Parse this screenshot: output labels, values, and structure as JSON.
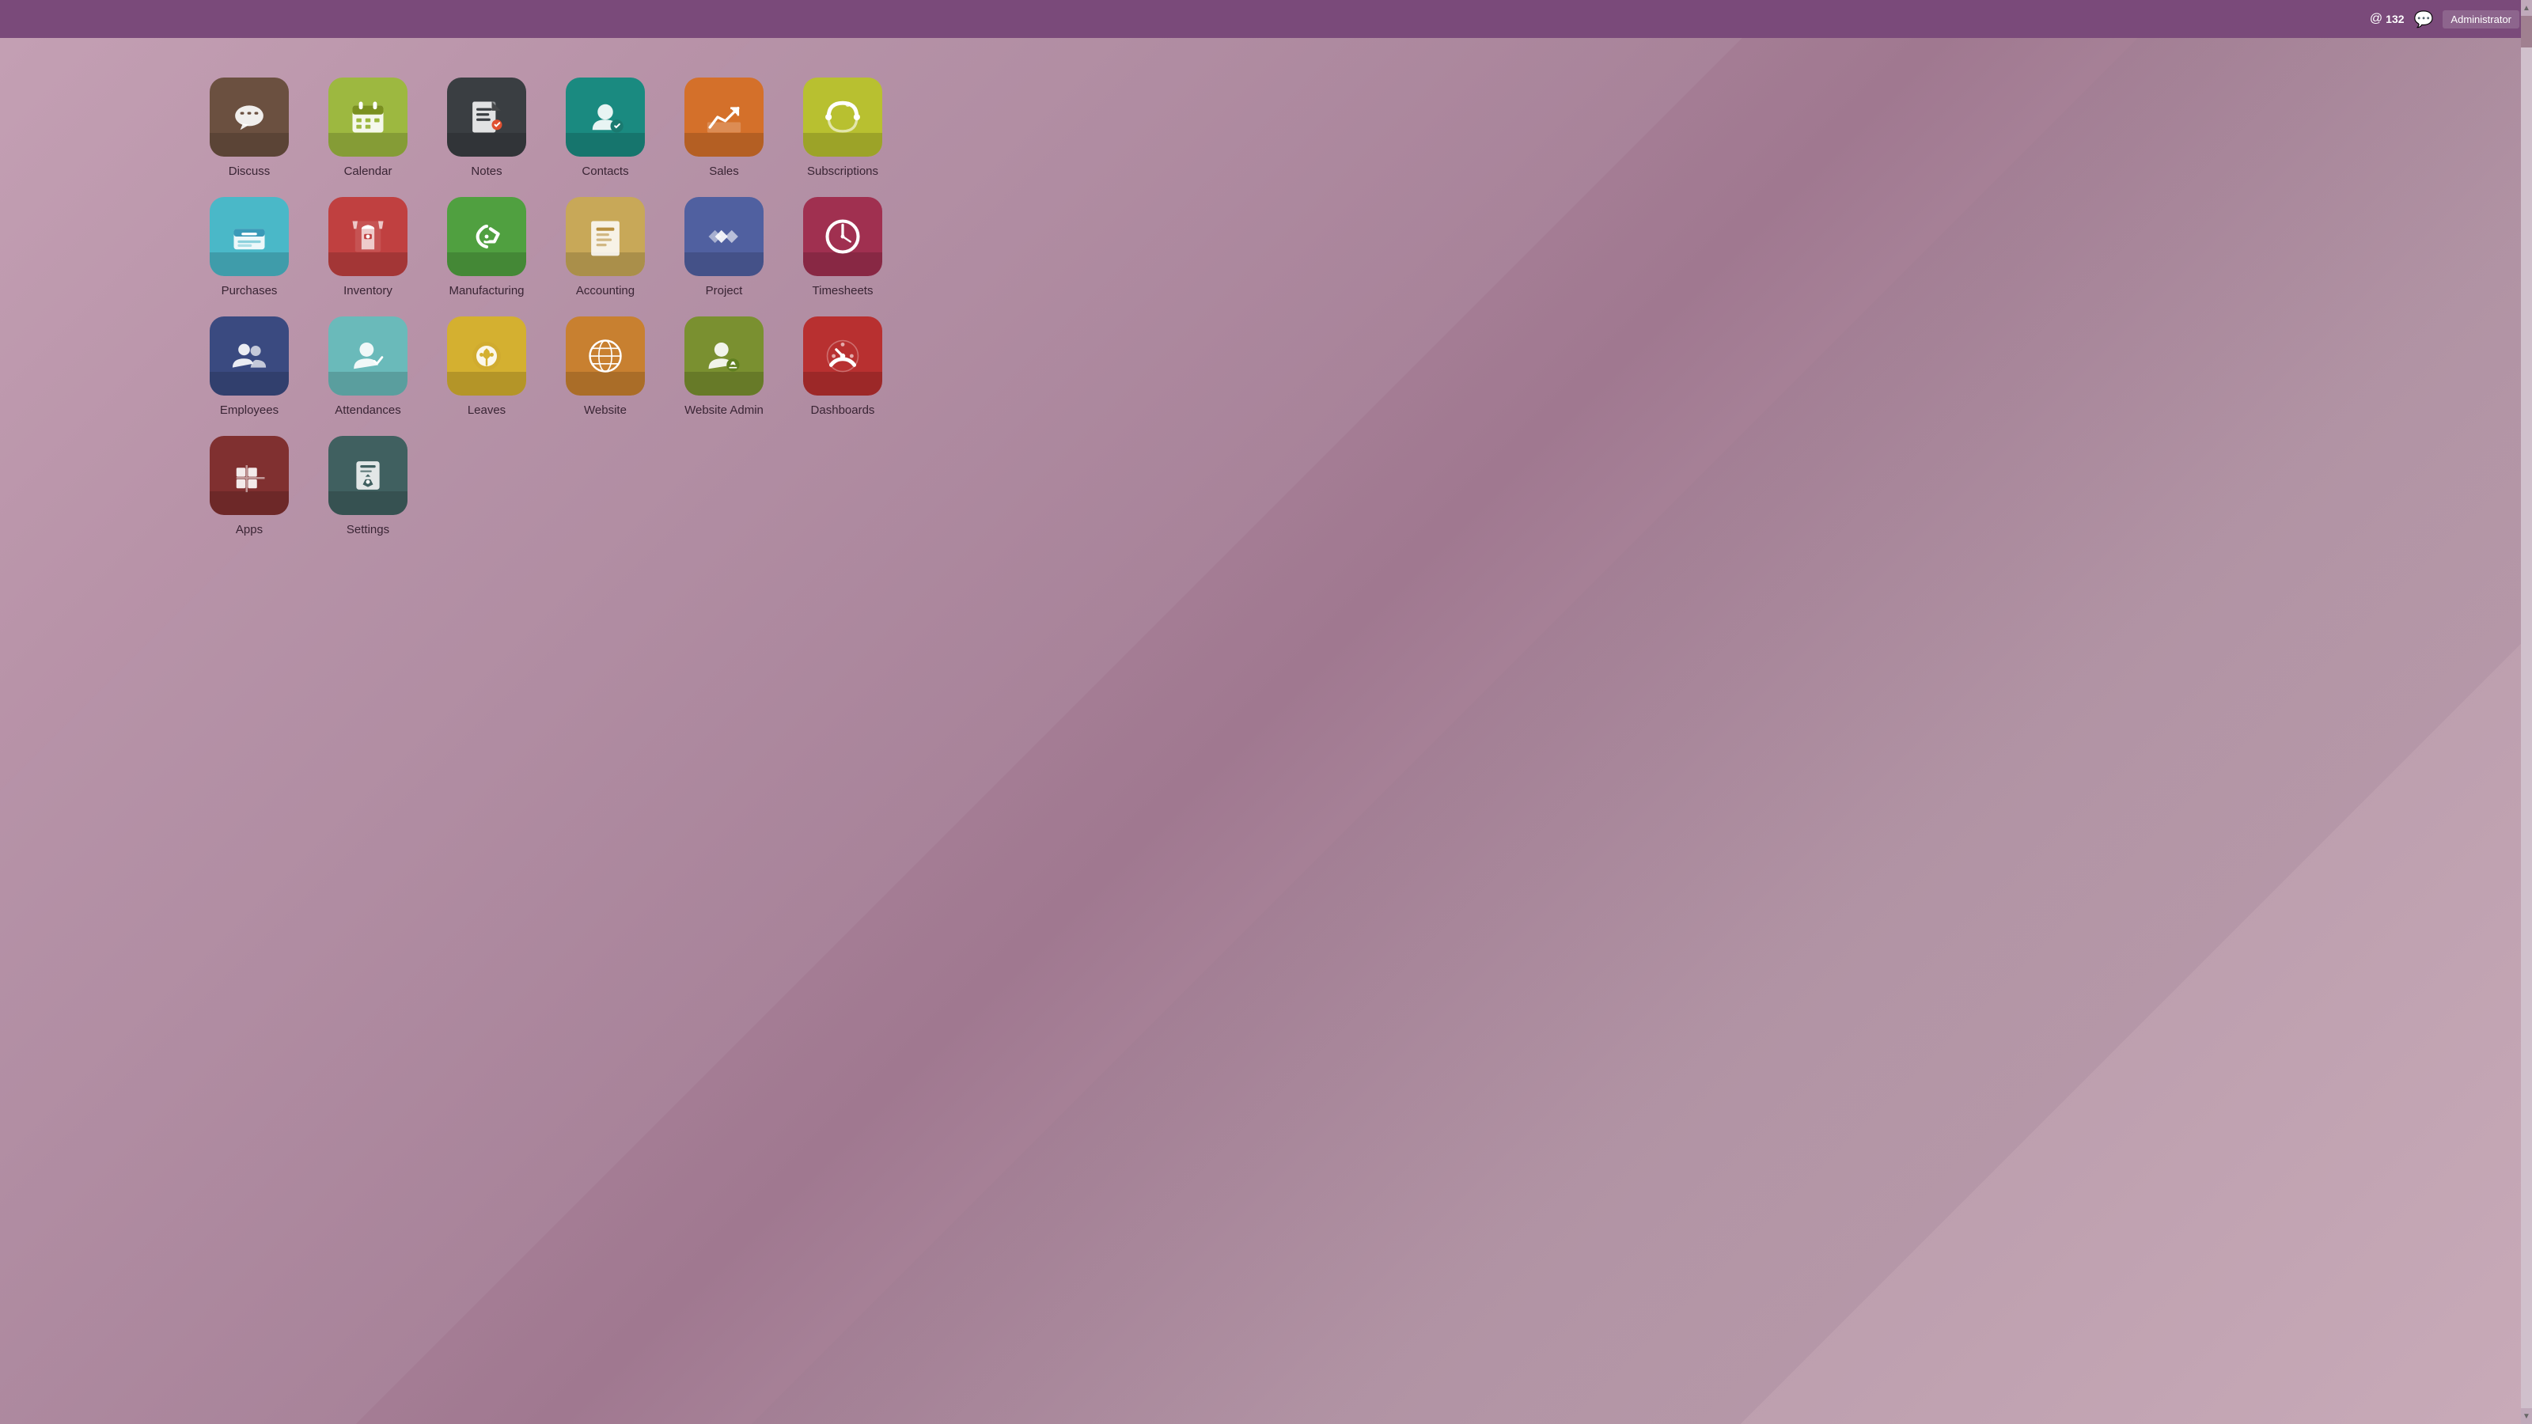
{
  "header": {
    "notification_icon": "@",
    "notification_count": "132",
    "chat_icon": "💬",
    "user_label": "Administrator"
  },
  "apps": [
    {
      "id": "discuss",
      "label": "Discuss",
      "color_class": "bg-brown",
      "icon": "discuss"
    },
    {
      "id": "calendar",
      "label": "Calendar",
      "color_class": "bg-lime",
      "icon": "calendar"
    },
    {
      "id": "notes",
      "label": "Notes",
      "color_class": "bg-darkgray",
      "icon": "notes"
    },
    {
      "id": "contacts",
      "label": "Contacts",
      "color_class": "bg-teal",
      "icon": "contacts"
    },
    {
      "id": "sales",
      "label": "Sales",
      "color_class": "bg-orange",
      "icon": "sales"
    },
    {
      "id": "subscriptions",
      "label": "Subscriptions",
      "color_class": "bg-yellow-green",
      "icon": "subscriptions"
    },
    {
      "id": "purchases",
      "label": "Purchases",
      "color_class": "bg-blue-light",
      "icon": "purchases"
    },
    {
      "id": "inventory",
      "label": "Inventory",
      "color_class": "bg-red-dark",
      "icon": "inventory"
    },
    {
      "id": "manufacturing",
      "label": "Manufacturing",
      "color_class": "bg-green",
      "icon": "manufacturing"
    },
    {
      "id": "accounting",
      "label": "Accounting",
      "color_class": "bg-tan",
      "icon": "accounting"
    },
    {
      "id": "project",
      "label": "Project",
      "color_class": "bg-purple",
      "icon": "project"
    },
    {
      "id": "timesheets",
      "label": "Timesheets",
      "color_class": "bg-dark-red",
      "icon": "timesheets"
    },
    {
      "id": "employees",
      "label": "Employees",
      "color_class": "bg-navy",
      "icon": "employees"
    },
    {
      "id": "attendances",
      "label": "Attendances",
      "color_class": "bg-teal-light",
      "icon": "attendances"
    },
    {
      "id": "leaves",
      "label": "Leaves",
      "color_class": "bg-yellow",
      "icon": "leaves"
    },
    {
      "id": "website",
      "label": "Website",
      "color_class": "bg-brown-warm",
      "icon": "website"
    },
    {
      "id": "website-admin",
      "label": "Website Admin",
      "color_class": "bg-olive",
      "icon": "website-admin"
    },
    {
      "id": "dashboards",
      "label": "Dashboards",
      "color_class": "bg-crimson",
      "icon": "dashboards"
    },
    {
      "id": "apps",
      "label": "Apps",
      "color_class": "bg-dark-brown",
      "icon": "apps"
    },
    {
      "id": "settings",
      "label": "Settings",
      "color_class": "bg-dark-teal",
      "icon": "settings"
    }
  ]
}
